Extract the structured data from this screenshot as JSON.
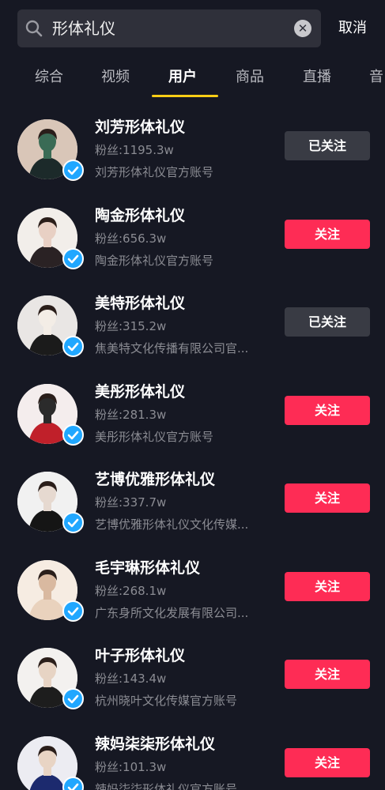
{
  "search": {
    "query": "形体礼仪",
    "cancel_label": "取消"
  },
  "tabs": [
    {
      "label": "综合"
    },
    {
      "label": "视频"
    },
    {
      "label": "用户"
    },
    {
      "label": "商品"
    },
    {
      "label": "直播"
    },
    {
      "label": "音"
    }
  ],
  "active_tab": "用户",
  "colors": {
    "background": "#161823",
    "accent_underline": "#face15",
    "follow_red": "#fe2c55",
    "followed_gray": "#393b44",
    "verified_blue": "#20a7ff"
  },
  "users": [
    {
      "name": "刘芳形体礼仪",
      "fans": "粉丝:1195.3w",
      "desc": "刘芳形体礼仪官方账号",
      "button": "已关注",
      "followed": true,
      "verified": true
    },
    {
      "name": "陶金形体礼仪",
      "fans": "粉丝:656.3w",
      "desc": "陶金形体礼仪官方账号",
      "button": "关注",
      "followed": false,
      "verified": true
    },
    {
      "name": "美特形体礼仪",
      "fans": "粉丝:315.2w",
      "desc": "焦美特文化传播有限公司官...",
      "button": "已关注",
      "followed": true,
      "verified": true
    },
    {
      "name": "美彤形体礼仪",
      "fans": "粉丝:281.3w",
      "desc": "美彤形体礼仪官方账号",
      "button": "关注",
      "followed": false,
      "verified": true
    },
    {
      "name": "艺博优雅形体礼仪",
      "fans": "粉丝:337.7w",
      "desc": "艺博优雅形体礼仪文化传媒...",
      "button": "关注",
      "followed": false,
      "verified": true
    },
    {
      "name": "毛宇琳形体礼仪",
      "fans": "粉丝:268.1w",
      "desc": "广东身所文化发展有限公司...",
      "button": "关注",
      "followed": false,
      "verified": true
    },
    {
      "name": "叶子形体礼仪",
      "fans": "粉丝:143.4w",
      "desc": "杭州晓叶文化传媒官方账号",
      "button": "关注",
      "followed": false,
      "verified": true
    },
    {
      "name": "辣妈柒柒形体礼仪",
      "fans": "粉丝:101.3w",
      "desc": "辣妈柒柒形体礼仪官方账号",
      "button": "关注",
      "followed": false,
      "verified": true
    }
  ]
}
